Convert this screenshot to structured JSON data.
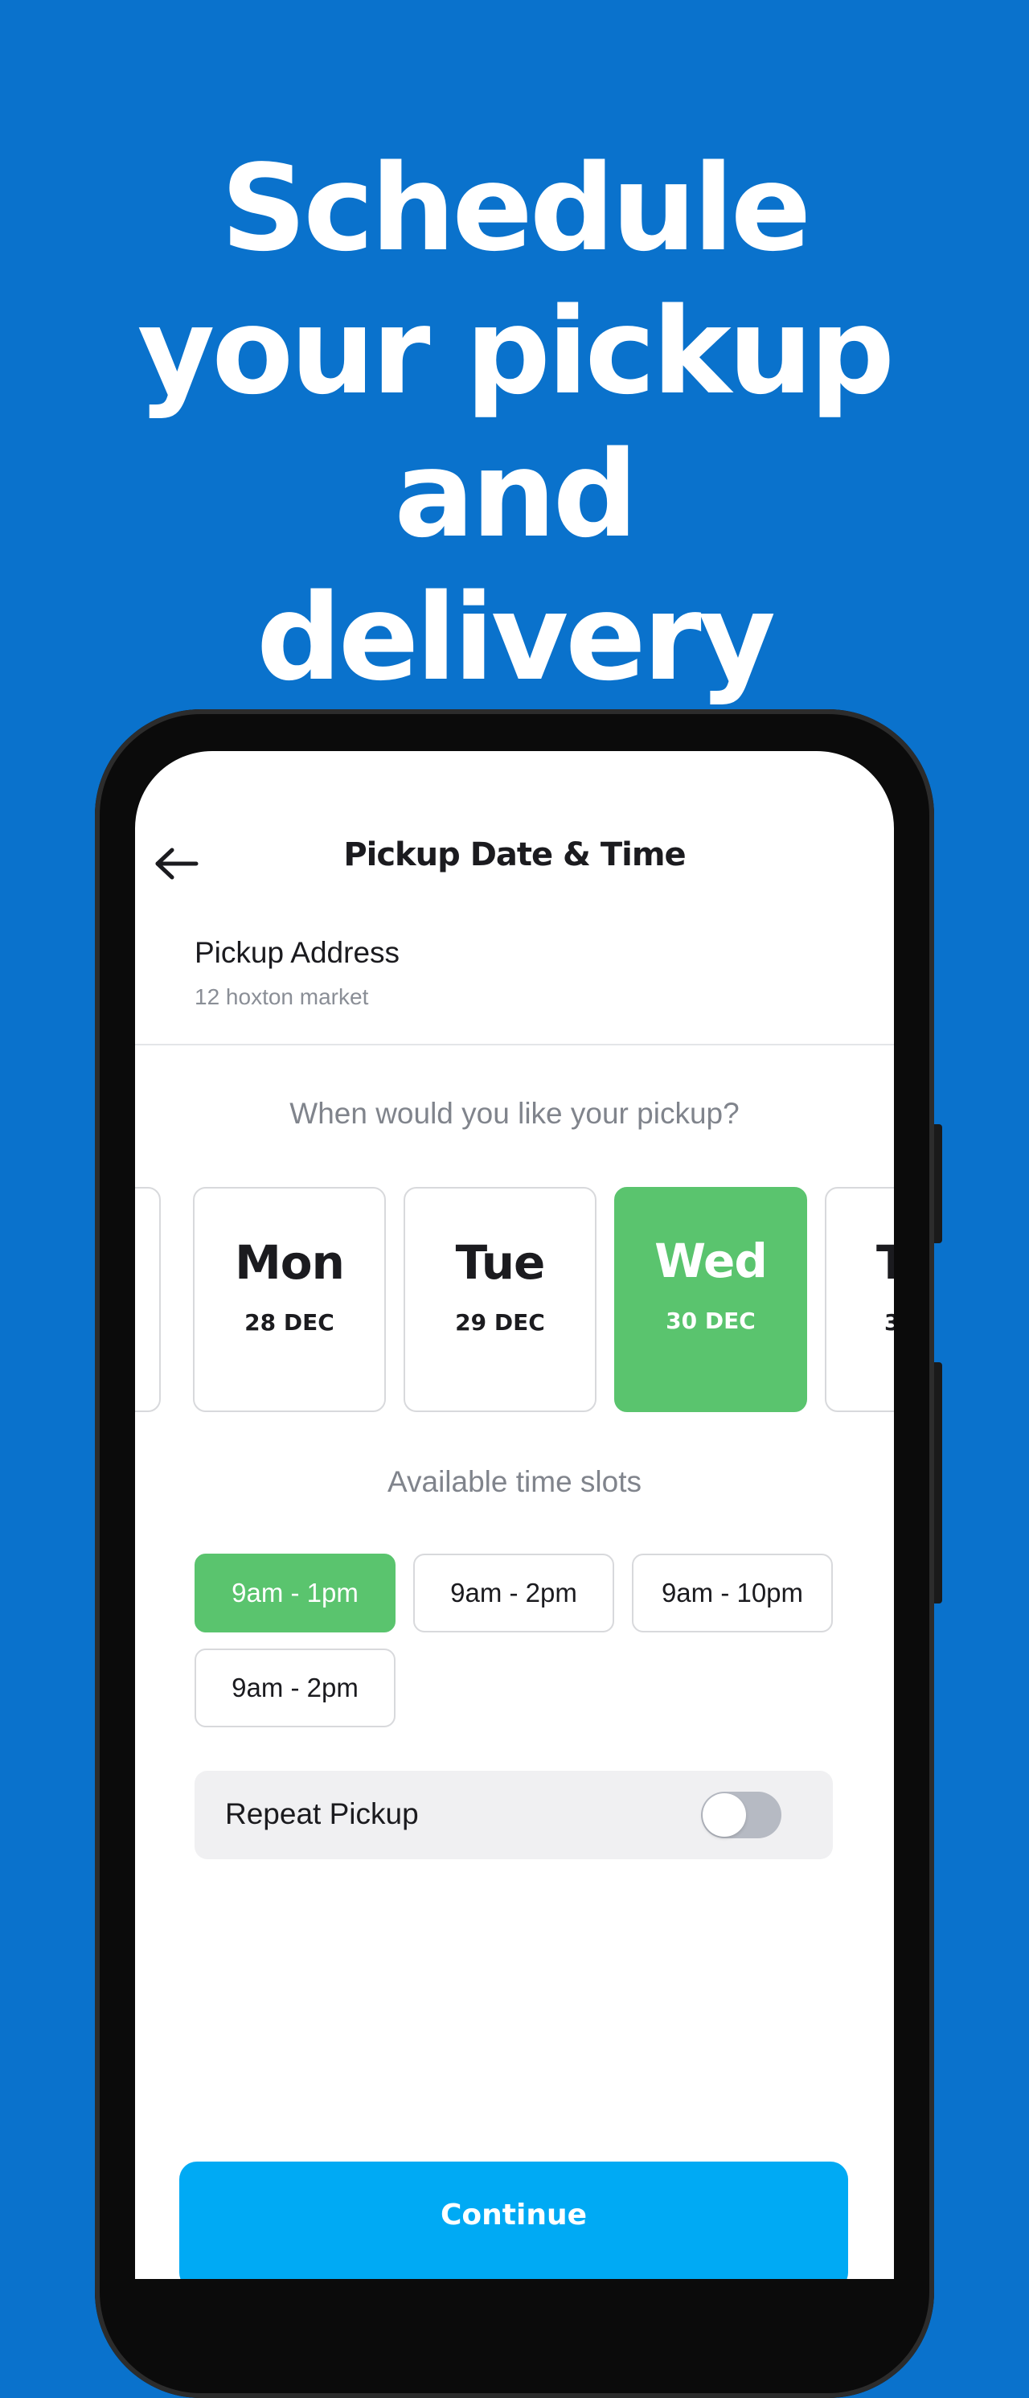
{
  "headline": {
    "line1": "Schedule",
    "line2": "your pickup and",
    "line3": "delivery"
  },
  "screen": {
    "back_icon": "arrow-left-icon",
    "title": "Pickup Date & Time",
    "pickup_address": {
      "label": "Pickup Address",
      "value": "12 hoxton market"
    },
    "question": "When would you like your pickup?",
    "days": [
      {
        "name": "",
        "date": ""
      },
      {
        "name": "Mon",
        "date": "28 DEC"
      },
      {
        "name": "Tue",
        "date": "29 DEC"
      },
      {
        "name": "Wed",
        "date": "30 DEC",
        "selected": true
      },
      {
        "name": "T",
        "date": "3"
      }
    ],
    "slots_title": "Available time slots",
    "slots": [
      {
        "label": "9am - 1pm",
        "selected": true
      },
      {
        "label": "9am - 2pm"
      },
      {
        "label": "9am - 10pm"
      },
      {
        "label": "9am - 2pm"
      }
    ],
    "repeat_pickup": {
      "label": "Repeat Pickup",
      "enabled": false
    },
    "continue_label": "Continue"
  },
  "colors": {
    "background": "#0a72cc",
    "selected": "#5ac46e",
    "primary_button": "#00aaf4"
  }
}
